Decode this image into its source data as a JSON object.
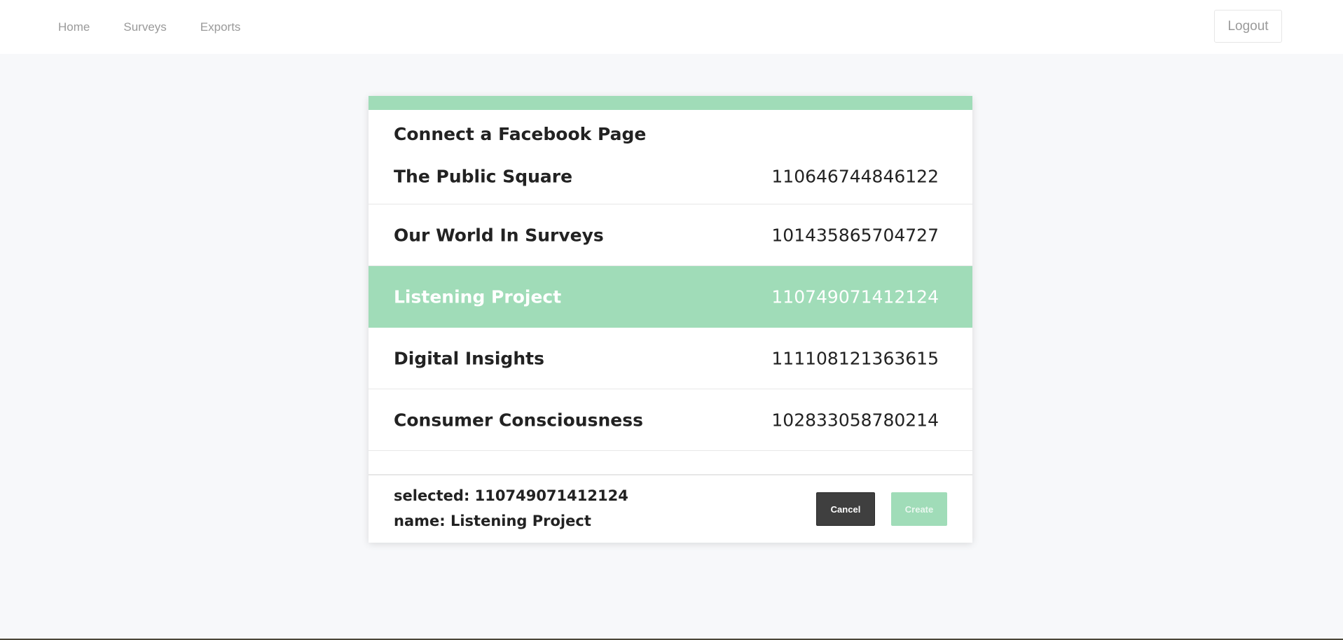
{
  "nav": {
    "links": [
      "Home",
      "Surveys",
      "Exports"
    ],
    "logout_label": "Logout"
  },
  "modal": {
    "title": "Connect a Facebook Page",
    "pages": [
      {
        "name": "The Public Square",
        "id": "110646744846122",
        "selected": false
      },
      {
        "name": "Our World In Surveys",
        "id": "101435865704727",
        "selected": false
      },
      {
        "name": "Listening Project",
        "id": "110749071412124",
        "selected": true
      },
      {
        "name": "Digital Insights",
        "id": "111108121363615",
        "selected": false
      },
      {
        "name": "Consumer Consciousness",
        "id": "102833058780214",
        "selected": false
      }
    ],
    "footer": {
      "selected_line": "selected: 110749071412124",
      "name_line": "name: Listening Project",
      "cancel_label": "Cancel",
      "create_label": "Create"
    }
  },
  "colors": {
    "accent": "#a0dcb8",
    "dark_button": "#3f3f3f",
    "background": "#f7f8fa"
  }
}
